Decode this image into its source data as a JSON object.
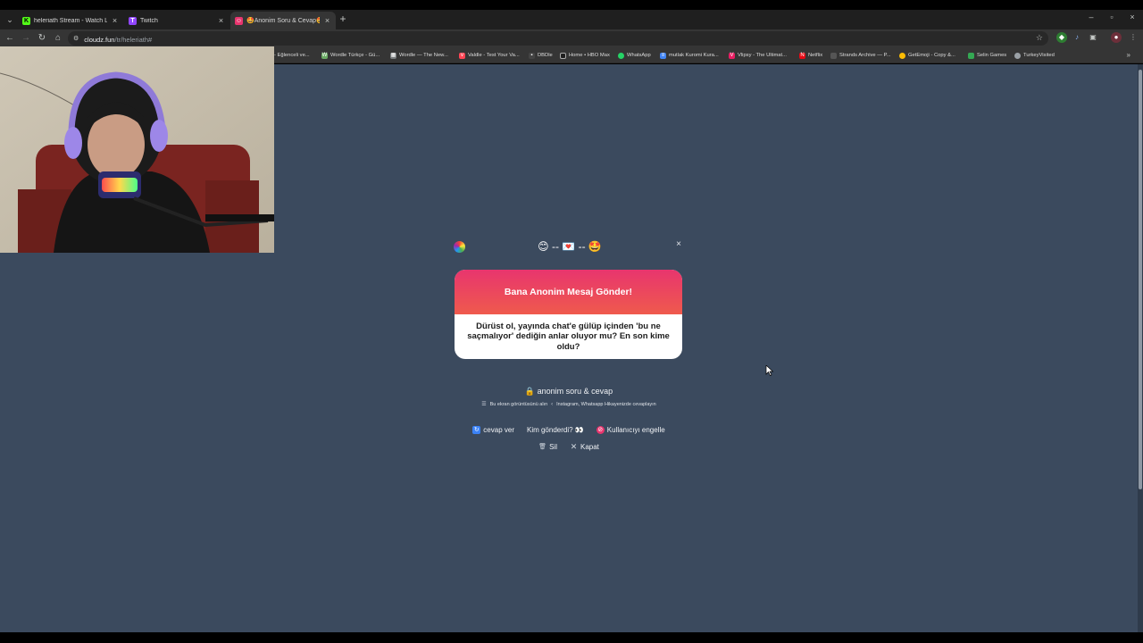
{
  "browser": {
    "tabs": [
      {
        "title": "heleriath Stream - Watch Live o",
        "favicon": "K",
        "color": "#53fc18",
        "active": false
      },
      {
        "title": "Twitch",
        "favicon": "T",
        "color": "#9146ff",
        "active": false
      },
      {
        "title": "🤩Anonim Soru & Cevap🤩 - c",
        "favicon": "☺",
        "color": "#e8356e",
        "active": true
      }
    ],
    "new_tab_label": "+",
    "url_host": "cloudz.fun",
    "url_path": "/tr/heleriath#",
    "bookmarks": [
      {
        "label": "- Eğlenceli ve...",
        "color": "#5f6368"
      },
      {
        "label": "Wordle Türkçe - Gü...",
        "color": "#6aaa64"
      },
      {
        "label": "Wordle — The New...",
        "color": "#787c7e"
      },
      {
        "label": "Valdle - Test Your Va...",
        "color": "#ff4655"
      },
      {
        "label": "DBDle",
        "color": "#444"
      },
      {
        "label": "Home • HBO Max",
        "color": "#1f1f1f"
      },
      {
        "label": "WhatsApp",
        "color": "#25d366"
      },
      {
        "label": "mutlak Kuromi Kura...",
        "color": "#4285f4"
      },
      {
        "label": "Vlipsy - The Ultimat...",
        "color": "#e91e63"
      },
      {
        "label": "Netflix",
        "color": "#e50914"
      },
      {
        "label": "Strands Archive — P...",
        "color": "#555"
      },
      {
        "label": "GetEmoji - Copy &...",
        "color": "#fbbc04"
      },
      {
        "label": "Selin Games",
        "color": "#34a853"
      },
      {
        "label": "TurkeyVisited",
        "color": "#9aa0a6"
      }
    ]
  },
  "modal": {
    "emoji_row": "😊 -- 💌 -- 🤩",
    "close_label": "×",
    "card_title": "Bana Anonim Mesaj Gönder!",
    "card_question": "Dürüst ol, yayında chat'e gülüp içinden 'bu ne saçmalıyor' dediğin anlar oluyor mu? En son kime oldu?",
    "brand": "🔒 anonim soru & cevap",
    "hint": "Bu ekran görüntüsünü alın",
    "hint_tail": "Instagram, Whatsapp Hikayenizde cevaplayın",
    "actions": {
      "reply": "cevap ver",
      "who_sent": "Kim gönderdi? 👀",
      "block_user": "Kullanıcıyı engelle",
      "delete": "Sil",
      "close": "Kapat"
    }
  }
}
